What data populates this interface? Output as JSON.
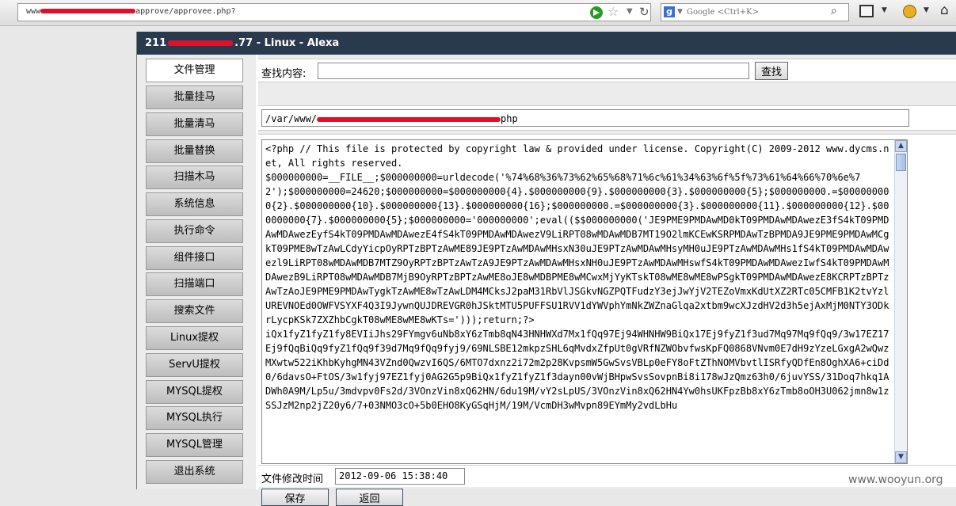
{
  "browser": {
    "url_prefix": "www",
    "url_suffix": "approve/approvee.php?",
    "search_placeholder": "Google <Ctrl+K>"
  },
  "window": {
    "title_prefix": "211",
    "title_mid": ".77",
    "title_suffix": " - Linux - Alexa"
  },
  "sidebar": {
    "items": [
      {
        "label": "文件管理",
        "active": true
      },
      {
        "label": "批量挂马"
      },
      {
        "label": "批量清马"
      },
      {
        "label": "批量替换"
      },
      {
        "label": "扫描木马"
      },
      {
        "label": "系统信息"
      },
      {
        "label": "执行命令"
      },
      {
        "label": "组件接口"
      },
      {
        "label": "扫描端口"
      },
      {
        "label": "搜索文件"
      },
      {
        "label": "Linux提权"
      },
      {
        "label": "ServU提权"
      },
      {
        "label": "MYSQL提权"
      },
      {
        "label": "MYSQL执行"
      },
      {
        "label": "MYSQL管理"
      },
      {
        "label": "退出系统"
      }
    ]
  },
  "main": {
    "search_label": "查找内容:",
    "search_value": "",
    "search_button": "查找",
    "path_prefix": "/var/www/",
    "path_suffix": "php",
    "code": "<?php // This file is protected by copyright law & provided under license. Copyright(C) 2009-2012 www.dycms.net, All rights reserved.\n$000000000=__FILE__;$000000000=urldecode('%74%68%36%73%62%65%68%71%6c%61%34%63%6f%5f%73%61%64%66%70%6e%72');$000000000=24620;$000000000=$000000000{4}.$000000000{9}.$000000000{3}.$000000000{5};$000000000.=$000000000{2}.$000000000{10}.$000000000{13}.$000000000{16};$000000000.=$000000000{3}.$000000000{11}.$000000000{12}.$000000000{7}.$000000000{5};$000000000='000000000';eval(($$000000000('JE9PME9PMDAwMD0kT09PMDAwMDAwezE3fS4kT09PMDAwMDAwezEyfS4kT09PMDAwMDAwezE4fS4kT09PMDAwMDAwezV9LiRPT08wMDAwMDB7MT19O2lmKCEwKSRPMDAwTzBPMDA9JE9PME9PMDAwMCgkT09PME8wTzAwLCdyYicpOyRPTzBPTzAwME89JE9PTzAwMDAwMHsxN30uJE9PTzAwMDAwMHsyMH0uJE9PTzAwMDAwMHs1fS4kT09PMDAwMDAwezl9LiRPT08wMDAwMDB7MTZ9OyRPTzBPTzAwTzA9JE9PTzAwMDAwMHsxNH0uJE9PTzAwMDAwMHswfS4kT09PMDAwMDAwezIwfS4kT09PMDAwMDAwezB9LiRPT08wMDAwMDB7MjB9OyRPTzBPTzAwME8oJE8wMDBPME8wMCwxMjYyKTskT08wME8wME8wPSgkT09PMDAwMDAwezE8KCRPTzBPTzAwTzAoJE9PME9PMDAwTygkTzAwME8wTzAwLDM4MCksJ2paM31RbVlJSGkvNGZPQTFudzY3ejJwYjV2TEZoVmxKdUtXZ2RTc05CMFB1K2tvYzlUREVNOEd0OWFVSYXF4Q3I9JywnQUJDREVGR0hJSktMTU5PUFFSU1RVV1dYWVphYmNkZWZnaGlqa2xtbm9wcXJzdHV2d3h5ejAxMjM0NTY3ODkrLycpKSk7ZXZhbCgkT08wME8wME8wKTs=')));return;?>\niQx1fyZ1fyZ1fy8EVIiJhs29FYmgv6uNb8xY6zTmb8qN43HNHWXd7Mx1fQq97Ej94WHNHW9BiQx17Ej9fyZ1f3ud7Mq97Mq9fQq9/3w17EZ17Ej9fQqBiQq9fyZ1fQq9f39d7Mq9fQq9fyj9/69NLSBE12mkpzSHL6qMvdxZfpUt0gVRfNZWObvfwsKpFQ0868VNvm0E7dH9zYzeLGxgA2wQwzMXwtw522iKhbKyhgMN43VZnd0QwzvI6QS/6MTO7dxnz2i72m2p28KvpsmW5GwSvsVBLp0eFY8oFtZThNOMVbvtlISRfyQDfEn8OghXA6+ciDd0/6davsO+FtOS/3w1fyj97EZ1fyj0AG2G5p9BiQx1fyZ1fyZ1f3dayn00vWjBHpwSvsSovpnBi8i178wJzQmz63h0/6juvYSS/31Doq7hkq1ADWh0A9M/Lp5u/3mdvpv0Fs2d/3VOnzVin8xQ62HN/6du19M/vY2sLpUS/3VOnzVin8xQ62HN4Yw0hsUKFpzBb8xY6zTmb8oOH3U062jmn8w1zSSJzM2np2jZ20y6/7+03NMO3cO+5b0EHO8KyGSqHjM/19M/VcmDH3wMvpn89EYmMy2vdLbHu"
  },
  "footer": {
    "time_label": "文件修改时间",
    "time_value": "2012-09-06 15:38:40",
    "save_button": "保存",
    "back_button": "返回"
  },
  "watermark": "www.wooyun.org",
  "colors": {
    "title_bar": "#2a3a4e",
    "redaction": "#e0102a"
  }
}
